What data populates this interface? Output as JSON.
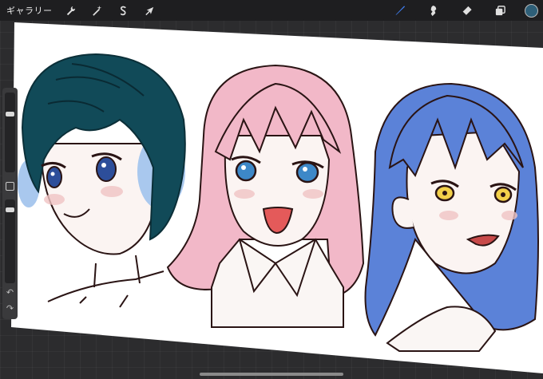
{
  "toolbar": {
    "gallery_label": "ギャラリー",
    "left_tools": [
      {
        "name": "actions",
        "icon": "wrench-icon"
      },
      {
        "name": "adjustments",
        "icon": "magic-wand-icon"
      },
      {
        "name": "selection",
        "icon": "selection-s-icon"
      },
      {
        "name": "transform",
        "icon": "arrow-cursor-icon"
      }
    ],
    "right_tools": [
      {
        "name": "brush",
        "icon": "brush-icon",
        "active": true
      },
      {
        "name": "smudge",
        "icon": "smudge-icon"
      },
      {
        "name": "eraser",
        "icon": "eraser-icon"
      },
      {
        "name": "layers",
        "icon": "layers-icon"
      }
    ],
    "current_color": "#2e5f78"
  },
  "colors": {
    "toolbar_bg": "#1e1e20",
    "active_tool": "#3f7df0",
    "canvas": "#ffffff",
    "hair_left": "#114a58",
    "hair_middle": "#f2b8c8",
    "hair_right": "#5b82d8",
    "earmuff": "#a9c8ee",
    "line_art": "#2a1414"
  },
  "sidebar": {
    "brush_size_level": 0.75,
    "opacity_level": 0.9,
    "undo_icon": "undo-icon",
    "redo_icon": "redo-icon"
  }
}
